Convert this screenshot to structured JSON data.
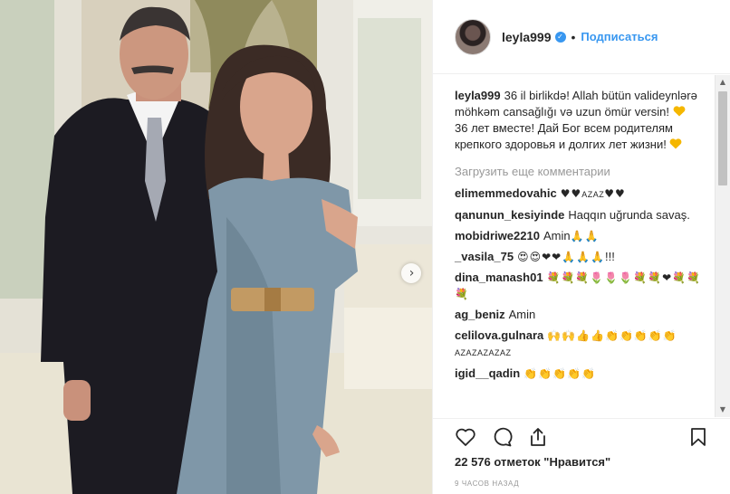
{
  "photo": {
    "next_icon": "chevron-right-icon",
    "next_label": "›"
  },
  "header": {
    "username": "leyla999",
    "verified_icon": "verified-badge-icon",
    "verified_mark": "✓",
    "separator": "•",
    "follow_label": "Подписаться"
  },
  "caption": {
    "username": "leyla999",
    "line1": "36 il birlikdə! Allah bütün valideynlərə möhkəm cansağlığı və uzun ömür versin!",
    "line2": "36 лет вместе! Дай Бог всем родителям крепкого здоровья и долгих лет жизни!",
    "heart_color": "#f5b700"
  },
  "load_more_label": "Загрузить еще комментарии",
  "comments": [
    {
      "user": "elimemmedovahic",
      "text": "♥♥",
      "small": "AZAZ",
      "text2": "♥♥"
    },
    {
      "user": "qanunun_kesiyinde",
      "text": "Haqqın uğrunda savaş."
    },
    {
      "user": "mobidriwe2210",
      "text": "Amin",
      "emoji": "🙏🙏"
    },
    {
      "user": "_vasila_75",
      "emoji": "😍😍❤❤🙏🙏🙏",
      "text": "!!!"
    },
    {
      "user": "dina_manash01",
      "emoji": "💐💐💐🌷🌷🌷💐💐❤💐💐💐"
    },
    {
      "user": "ag_beniz",
      "text": "Amin"
    },
    {
      "user": "celilova.gulnara",
      "emoji": "🙌🙌👍👍👏👏👏👏👏",
      "small": "AZAZAZAZAZ"
    },
    {
      "user": "igid__qadin",
      "emoji": "👏👏👏👏👏"
    }
  ],
  "actions": {
    "like_icon": "heart-outline-icon",
    "comment_icon": "comment-icon",
    "share_icon": "share-icon",
    "save_icon": "bookmark-icon",
    "likes_text": "22 576 отметок \"Нравится\"",
    "time_text": "9 часов назад"
  },
  "scrollbar": {
    "up": "▲",
    "down": "▼"
  }
}
